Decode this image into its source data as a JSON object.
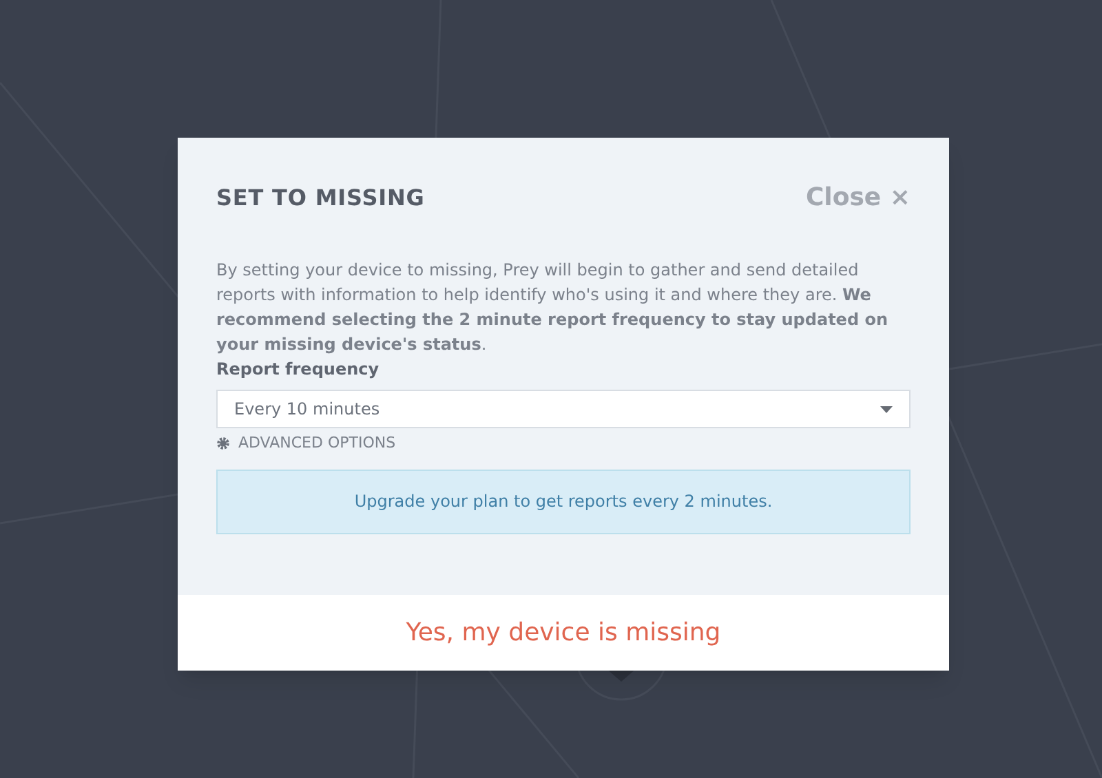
{
  "dialog": {
    "title": "SET TO MISSING",
    "close": "Close ×",
    "description": "By setting your device to missing, Prey will begin to gather and send detailed reports with information to help identify who's using it and where they are. **We recommend selecting the 2 minute report frequency to stay updated on your missing device's status**.",
    "field_label": "Report frequency",
    "select": {
      "value": "Every 10 minutes"
    },
    "advanced_options": "ADVANCED OPTIONS",
    "notice": "Upgrade your plan to get reports every 2 minutes.",
    "confirm_button": "Yes, my device is missing"
  }
}
